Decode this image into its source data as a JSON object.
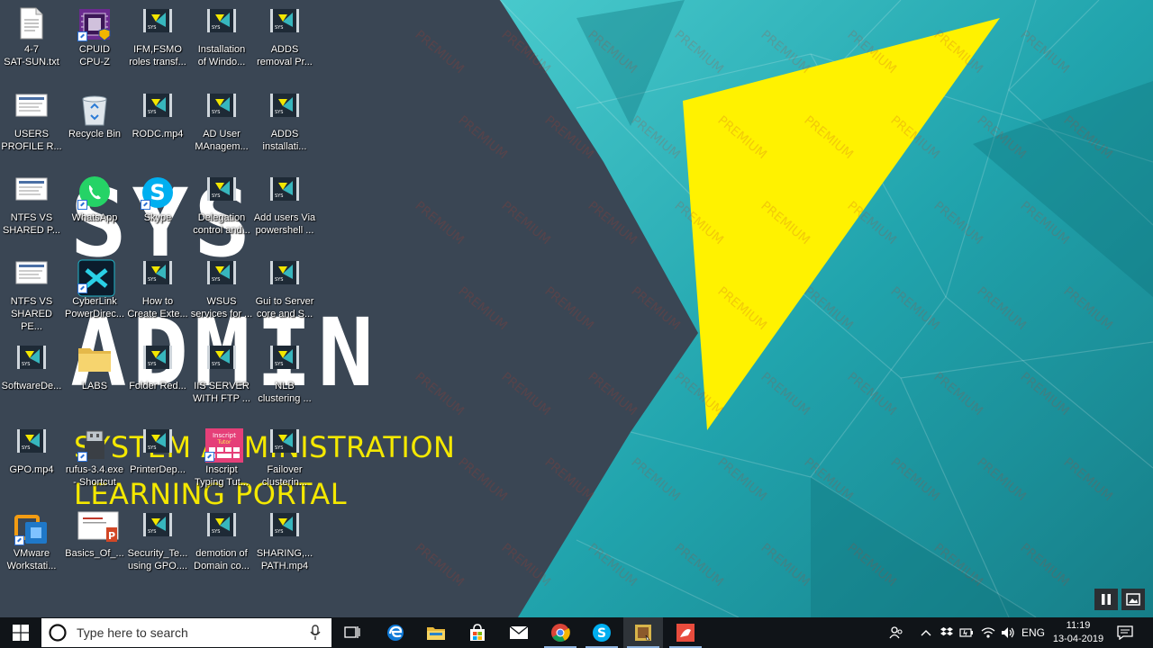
{
  "brand": {
    "big1": "SYS",
    "big2": "ADMIN",
    "line1": "SYSTEM ADMINISTRATION",
    "line2": "LEARNING PORTAL"
  },
  "wallpaper": {
    "watermark": "PREMIUM"
  },
  "desktop_icons": [
    {
      "label": "4-7\nSAT-SUN.txt",
      "icon": "text-file-icon"
    },
    {
      "label": "CPUID\nCPU-Z",
      "icon": "cpuz-icon"
    },
    {
      "label": "IFM,FSMO\nroles transf...",
      "icon": "video-file-icon"
    },
    {
      "label": "Installation\nof Windo...",
      "icon": "video-file-icon"
    },
    {
      "label": "ADDS\nremoval Pr...",
      "icon": "video-file-icon"
    },
    {
      "label": "USERS\nPROFILE R...",
      "icon": "document-thumbnail-icon"
    },
    {
      "label": "Recycle Bin",
      "icon": "recycle-bin-icon"
    },
    {
      "label": "RODC.mp4",
      "icon": "video-file-icon"
    },
    {
      "label": "AD User\nMAnagem...",
      "icon": "video-file-icon"
    },
    {
      "label": "ADDS\ninstallati...",
      "icon": "video-file-icon"
    },
    {
      "label": "NTFS VS\nSHARED P...",
      "icon": "document-thumbnail-icon"
    },
    {
      "label": "WhatsApp",
      "icon": "whatsapp-icon"
    },
    {
      "label": "Skype",
      "icon": "skype-icon"
    },
    {
      "label": "Delegation\ncontrol and...",
      "icon": "video-file-icon"
    },
    {
      "label": "Add users Via\npowershell ...",
      "icon": "video-file-icon"
    },
    {
      "label": "NTFS VS\nSHARED PE...",
      "icon": "document-thumbnail-icon"
    },
    {
      "label": "CyberLink\nPowerDirec...",
      "icon": "cyberlink-icon"
    },
    {
      "label": "How to\nCreate Exte...",
      "icon": "video-file-icon"
    },
    {
      "label": "WSUS\nservices for ...",
      "icon": "video-file-icon"
    },
    {
      "label": "Gui to Server\ncore and S...",
      "icon": "video-file-icon"
    },
    {
      "label": "SoftwareDe...",
      "icon": "video-file-icon"
    },
    {
      "label": "LABS",
      "icon": "folder-icon"
    },
    {
      "label": "Folder Red...",
      "icon": "video-file-icon"
    },
    {
      "label": "IIS SERVER\nWITH FTP ...",
      "icon": "video-file-icon"
    },
    {
      "label": "NLB\nclustering ...",
      "icon": "video-file-icon"
    },
    {
      "label": "GPO.mp4",
      "icon": "video-file-icon"
    },
    {
      "label": "rufus-3.4.exe\n- Shortcut",
      "icon": "rufus-icon"
    },
    {
      "label": "PrinterDep...",
      "icon": "video-file-icon"
    },
    {
      "label": "Inscript\nTyping Tut...",
      "icon": "inscript-icon"
    },
    {
      "label": "Failover\nclusterin...",
      "icon": "video-file-icon"
    },
    {
      "label": "VMware\nWorkstati...",
      "icon": "vmware-icon"
    },
    {
      "label": "Basics_Of_...",
      "icon": "powerpoint-icon"
    },
    {
      "label": "Security_Te...\nusing GPO....",
      "icon": "video-file-icon"
    },
    {
      "label": "demotion of\nDomain co...",
      "icon": "video-file-icon"
    },
    {
      "label": "SHARING,...\nPATH.mp4",
      "icon": "video-file-icon"
    }
  ],
  "inscript_badge": "Inscript\nTutor",
  "taskbar": {
    "search_placeholder": "Type here to search",
    "pinned": [
      "task-view-icon",
      "edge-icon",
      "file-explorer-icon",
      "store-icon",
      "mail-icon",
      "chrome-icon",
      "skype-icon",
      "file-manager-icon",
      "screen-recorder-icon"
    ],
    "language": "ENG",
    "time": "11:19",
    "date": "13-04-2019"
  },
  "colors": {
    "taskbar": "#101418",
    "brand_yellow": "#f4e800",
    "teal": "#2fb6bd",
    "slate": "#3a4654"
  }
}
